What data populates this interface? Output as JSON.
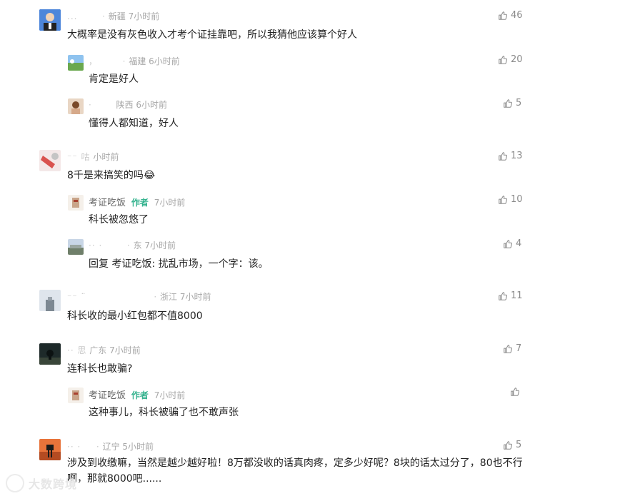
{
  "comments": [
    {
      "name": "...",
      "location": "新疆",
      "time": "7小时前",
      "text": "大概率是没有灰色收入才考个证挂靠吧，所以我猜他应该算个好人",
      "likes": "46"
    },
    {
      "name": "，",
      "location": "福建",
      "time": "6小时前",
      "text": "肯定是好人",
      "likes": "20"
    },
    {
      "name": "·",
      "location": "陕西",
      "time": "6小时前",
      "text": "懂得人都知道，好人",
      "likes": "5"
    },
    {
      "name": "⁻⁻ 咕",
      "location": "",
      "time": "小时前",
      "text": "8千是来搞笑的吗😂",
      "likes": "13"
    },
    {
      "name": "考证吃饭",
      "author_badge": "作者",
      "location": "",
      "time": "7小时前",
      "text": "科长被忽悠了",
      "likes": "10"
    },
    {
      "name": "·· ·",
      "location": "东",
      "time": "7小时前",
      "text": "回复 考证吃饭: 扰乱市场，一个字：该。",
      "likes": "4"
    },
    {
      "name": "⁻⁻ ¨",
      "location": "浙江",
      "time": "7小时前",
      "text": "科长收的最小红包都不值8000",
      "likes": "11"
    },
    {
      "name": "·· 思",
      "location": "广东",
      "time": "7小时前",
      "text": "连科长也敢骗?",
      "likes": "7"
    },
    {
      "name": "考证吃饭",
      "author_badge": "作者",
      "location": "",
      "time": "7小时前",
      "text": "这种事儿，科长被骗了也不敢声张",
      "likes": ""
    },
    {
      "name": "·· ·",
      "location": "辽宁",
      "time": "5小时前",
      "text": "涉及到收缴嘛，当然是越少越好啦！8万都没收的话真肉疼，定多少好呢？8块的话太过分了，80也不行啊，那就8000吧......",
      "likes": "5"
    }
  ],
  "watermark": {
    "text": "大数跨境"
  },
  "icons": {
    "like": "thumbs-up-icon"
  }
}
